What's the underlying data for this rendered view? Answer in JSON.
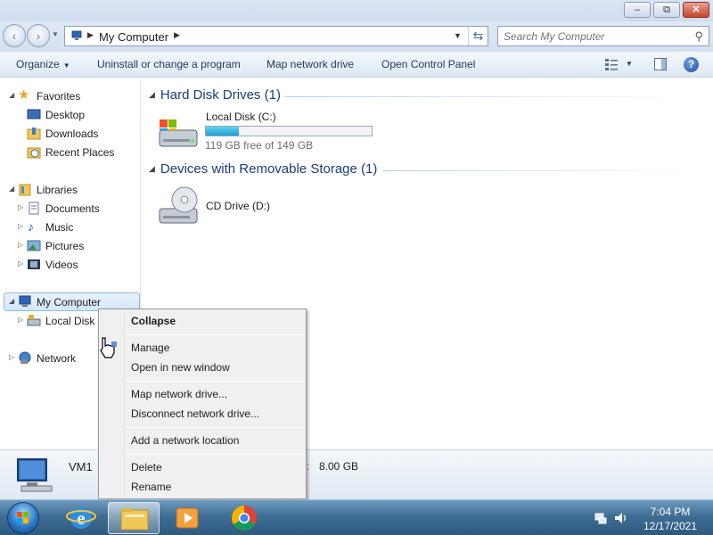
{
  "window": {
    "minimize": "–",
    "maximize": "⧉",
    "close": "✕"
  },
  "nav": {
    "back": "‹",
    "forward": "›"
  },
  "address": {
    "crumb": "My Computer"
  },
  "search": {
    "placeholder": "Search My Computer"
  },
  "commandbar": {
    "organize": "Organize",
    "uninstall": "Uninstall or change a program",
    "map_drive": "Map network drive",
    "control_panel": "Open Control Panel",
    "help": "?"
  },
  "navpane": {
    "favorites": "Favorites",
    "desktop": "Desktop",
    "downloads": "Downloads",
    "recent_places": "Recent Places",
    "libraries": "Libraries",
    "documents": "Documents",
    "music": "Music",
    "pictures": "Pictures",
    "videos": "Videos",
    "my_computer": "My Computer",
    "local_disk": "Local Disk (",
    "network": "Network"
  },
  "content": {
    "hdd_group": "Hard Disk Drives (1)",
    "local_disk_name": "Local Disk (C:)",
    "local_disk_free": "119 GB free of 149 GB",
    "local_disk_used_fraction": 0.2,
    "removable_group": "Devices with Removable Storage (1)",
    "cd_drive_name": "CD Drive (D:)"
  },
  "details": {
    "computer_name": "VM1",
    "memory_label": "y:",
    "memory_value": "8.00 GB"
  },
  "context_menu": {
    "collapse": "Collapse",
    "manage": "Manage",
    "open_new_window": "Open in new window",
    "map_network_drive": "Map network drive...",
    "disconnect_network_drive": "Disconnect network drive...",
    "add_network_location": "Add a network location",
    "delete": "Delete",
    "rename": "Rename"
  },
  "taskbar": {
    "time": "7:04 PM",
    "date": "12/17/2021"
  },
  "colors": {
    "accent": "#1e3c78",
    "capacity_fill": "#1d9fd1",
    "taskbar": "#3f6d94"
  }
}
